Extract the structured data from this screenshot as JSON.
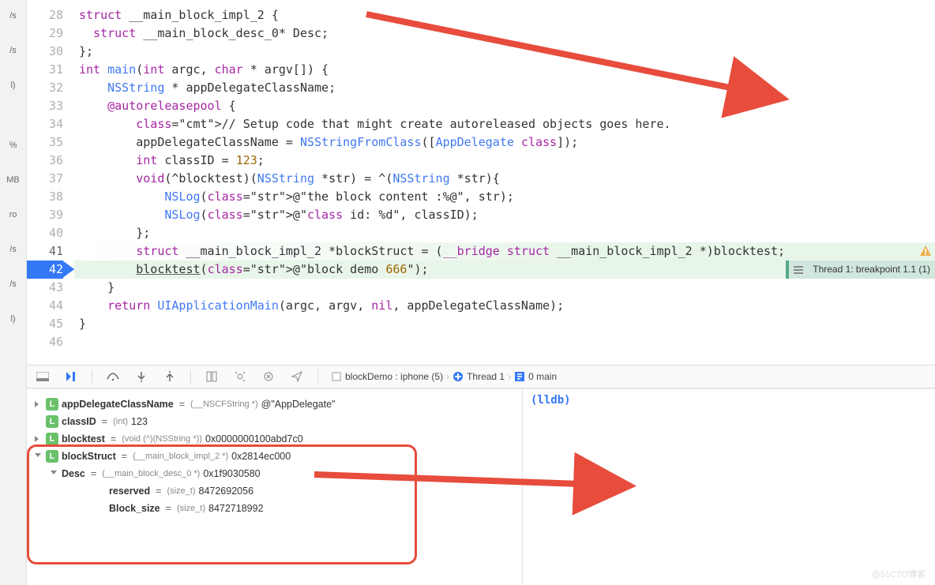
{
  "left_strip": [
    "/s",
    "/s",
    "l)",
    "",
    "%",
    "MB",
    "ro",
    "/s",
    "/s",
    "l)"
  ],
  "code": {
    "lines": [
      {
        "n": 28,
        "html": "struct __main_block_impl_2 {"
      },
      {
        "n": 29,
        "html": "  struct __main_block_desc_0* Desc;"
      },
      {
        "n": 30,
        "html": "};"
      },
      {
        "n": 31,
        "html": "int main(int argc, char * argv[]) {"
      },
      {
        "n": 32,
        "html": "    NSString * appDelegateClassName;"
      },
      {
        "n": 33,
        "html": "    @autoreleasepool {"
      },
      {
        "n": 34,
        "html": "        // Setup code that might create autoreleased objects goes here."
      },
      {
        "n": 35,
        "html": "        appDelegateClassName = NSStringFromClass([AppDelegate class]);"
      },
      {
        "n": 36,
        "html": "        int classID = 123;"
      },
      {
        "n": 37,
        "html": "        void(^blocktest)(NSString *str) = ^(NSString *str){"
      },
      {
        "n": 38,
        "html": "            NSLog(@\"the block content :%@\", str);"
      },
      {
        "n": 39,
        "html": "            NSLog(@\"class id: %d\", classID);"
      },
      {
        "n": 40,
        "html": "        };"
      },
      {
        "n": 41,
        "html": "        struct __main_block_impl_2 *blockStruct = (__bridge struct __main_block_impl_2 *)blocktest;"
      },
      {
        "n": 42,
        "html": "        blocktest(@\"block demo 666\");"
      },
      {
        "n": 43,
        "html": "    }"
      },
      {
        "n": 44,
        "html": "    return UIApplicationMain(argc, argv, nil, appDelegateClassName);"
      },
      {
        "n": 45,
        "html": "}"
      },
      {
        "n": 46,
        "html": ""
      }
    ],
    "highlight_line": 42,
    "warn_line": 41,
    "thread_badge": "Thread 1: breakpoint 1.1 (1)"
  },
  "breadcrumbs": {
    "process": "blockDemo : iphone (5)",
    "thread": "Thread 1",
    "frame": "0 main"
  },
  "variables": {
    "rows": [
      {
        "name": "appDelegateClassName",
        "type": "(__NSCFString *)",
        "value": "@\"AppDelegate\"",
        "level": 0,
        "icon": "L",
        "disc": "closed"
      },
      {
        "name": "classID",
        "type": "(int)",
        "value": "123",
        "level": 0,
        "icon": "L",
        "disc": "none"
      },
      {
        "name": "blocktest",
        "type": "(void (^)(NSString *))",
        "value": "0x0000000100abd7c0",
        "level": 0,
        "icon": "L",
        "disc": "closed"
      },
      {
        "name": "blockStruct",
        "type": "(__main_block_impl_2 *)",
        "value": "0x2814ec000",
        "level": 0,
        "icon": "L",
        "disc": "open"
      },
      {
        "name": "Desc",
        "type": "(__main_block_desc_0 *)",
        "value": "0x1f9030580",
        "level": 1,
        "icon": "",
        "disc": "open"
      },
      {
        "name": "reserved",
        "type": "(size_t)",
        "value": "8472692056",
        "level": 2,
        "icon": "",
        "disc": "none"
      },
      {
        "name": "Block_size",
        "type": "(size_t)",
        "value": "8472718992",
        "level": 2,
        "icon": "",
        "disc": "none"
      }
    ]
  },
  "console": {
    "prompt": "(lldb)"
  },
  "watermark": "@51CTO博客"
}
